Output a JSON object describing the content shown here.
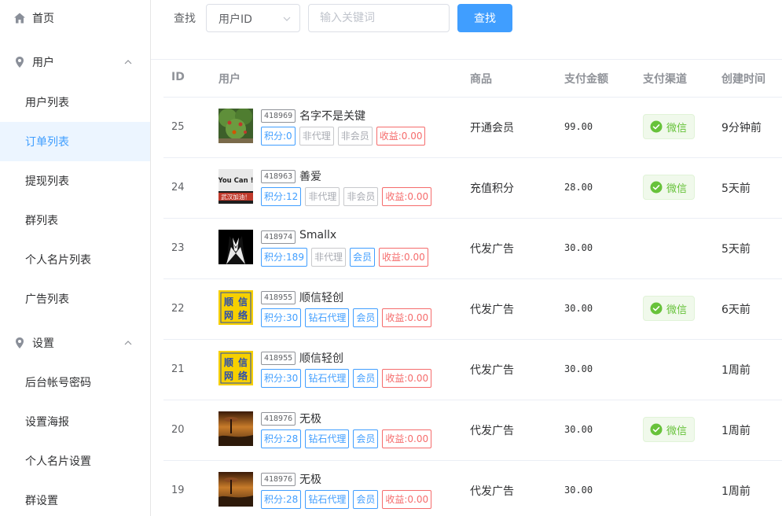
{
  "sidebar": {
    "home": {
      "label": "首页",
      "icon": "home-icon"
    },
    "groups": [
      {
        "label": "用户",
        "icon": "location-pin-icon",
        "items": [
          {
            "label": "用户列表"
          },
          {
            "label": "订单列表",
            "active": true
          },
          {
            "label": "提现列表"
          },
          {
            "label": "群列表"
          },
          {
            "label": "个人名片列表"
          },
          {
            "label": "广告列表"
          }
        ]
      },
      {
        "label": "设置",
        "icon": "location-pin-icon",
        "items": [
          {
            "label": "后台帐号密码"
          },
          {
            "label": "设置海报"
          },
          {
            "label": "个人名片设置"
          },
          {
            "label": "群设置"
          }
        ]
      }
    ]
  },
  "toolbar": {
    "label": "查找",
    "select_value": "用户ID",
    "keyword_placeholder": "输入关键词",
    "search_button": "查找"
  },
  "table": {
    "columns": [
      "ID",
      "用户",
      "商品",
      "支付金额",
      "支付渠道",
      "创建时间"
    ],
    "rows": [
      {
        "id": "25",
        "uid": "418969",
        "name": "名字不是关键",
        "avatar": "tree",
        "tags": [
          {
            "text": "积分:0",
            "style": "blue"
          },
          {
            "text": "非代理",
            "style": "gray"
          },
          {
            "text": "非会员",
            "style": "gray"
          },
          {
            "text": "收益:0.00",
            "style": "red"
          }
        ],
        "product": "开通会员",
        "amount": "99.00",
        "pay": "微信",
        "time": "9分钟前"
      },
      {
        "id": "24",
        "uid": "418963",
        "name": "善爱",
        "avatar": "youcan",
        "tags": [
          {
            "text": "积分:12",
            "style": "blue"
          },
          {
            "text": "非代理",
            "style": "gray"
          },
          {
            "text": "非会员",
            "style": "gray"
          },
          {
            "text": "收益:0.00",
            "style": "red"
          }
        ],
        "product": "充值积分",
        "amount": "28.00",
        "pay": "微信",
        "time": "5天前"
      },
      {
        "id": "23",
        "uid": "418974",
        "name": "Smallx",
        "avatar": "suit",
        "tags": [
          {
            "text": "积分:189",
            "style": "blue"
          },
          {
            "text": "非代理",
            "style": "gray"
          },
          {
            "text": "会员",
            "style": "blue"
          },
          {
            "text": "收益:0.00",
            "style": "red"
          }
        ],
        "product": "代发广告",
        "amount": "30.00",
        "pay": "",
        "time": "5天前"
      },
      {
        "id": "22",
        "uid": "418955",
        "name": "顺信轻创",
        "avatar": "yellow",
        "tags": [
          {
            "text": "积分:30",
            "style": "blue"
          },
          {
            "text": "钻石代理",
            "style": "blue"
          },
          {
            "text": "会员",
            "style": "blue"
          },
          {
            "text": "收益:0.00",
            "style": "red"
          }
        ],
        "product": "代发广告",
        "amount": "30.00",
        "pay": "微信",
        "time": "6天前"
      },
      {
        "id": "21",
        "uid": "418955",
        "name": "顺信轻创",
        "avatar": "yellow",
        "tags": [
          {
            "text": "积分:30",
            "style": "blue"
          },
          {
            "text": "钻石代理",
            "style": "blue"
          },
          {
            "text": "会员",
            "style": "blue"
          },
          {
            "text": "收益:0.00",
            "style": "red"
          }
        ],
        "product": "代发广告",
        "amount": "30.00",
        "pay": "",
        "time": "1周前"
      },
      {
        "id": "20",
        "uid": "418976",
        "name": "无极",
        "avatar": "sunset",
        "tags": [
          {
            "text": "积分:28",
            "style": "blue"
          },
          {
            "text": "钻石代理",
            "style": "blue"
          },
          {
            "text": "会员",
            "style": "blue"
          },
          {
            "text": "收益:0.00",
            "style": "red"
          }
        ],
        "product": "代发广告",
        "amount": "30.00",
        "pay": "微信",
        "time": "1周前"
      },
      {
        "id": "19",
        "uid": "418976",
        "name": "无极",
        "avatar": "sunset",
        "tags": [
          {
            "text": "积分:28",
            "style": "blue"
          },
          {
            "text": "钻石代理",
            "style": "blue"
          },
          {
            "text": "会员",
            "style": "blue"
          },
          {
            "text": "收益:0.00",
            "style": "red"
          }
        ],
        "product": "代发广告",
        "amount": "30.00",
        "pay": "",
        "time": "1周前"
      }
    ]
  },
  "avatars": {
    "youcan": {
      "line1": "You Can !",
      "line2": "武汉加油！"
    },
    "yellow": {
      "chars": [
        "顺",
        "信",
        "网",
        "络"
      ]
    }
  },
  "colors": {
    "accent": "#409eff",
    "wechat": "#67c23a",
    "danger": "#f56c6c"
  }
}
